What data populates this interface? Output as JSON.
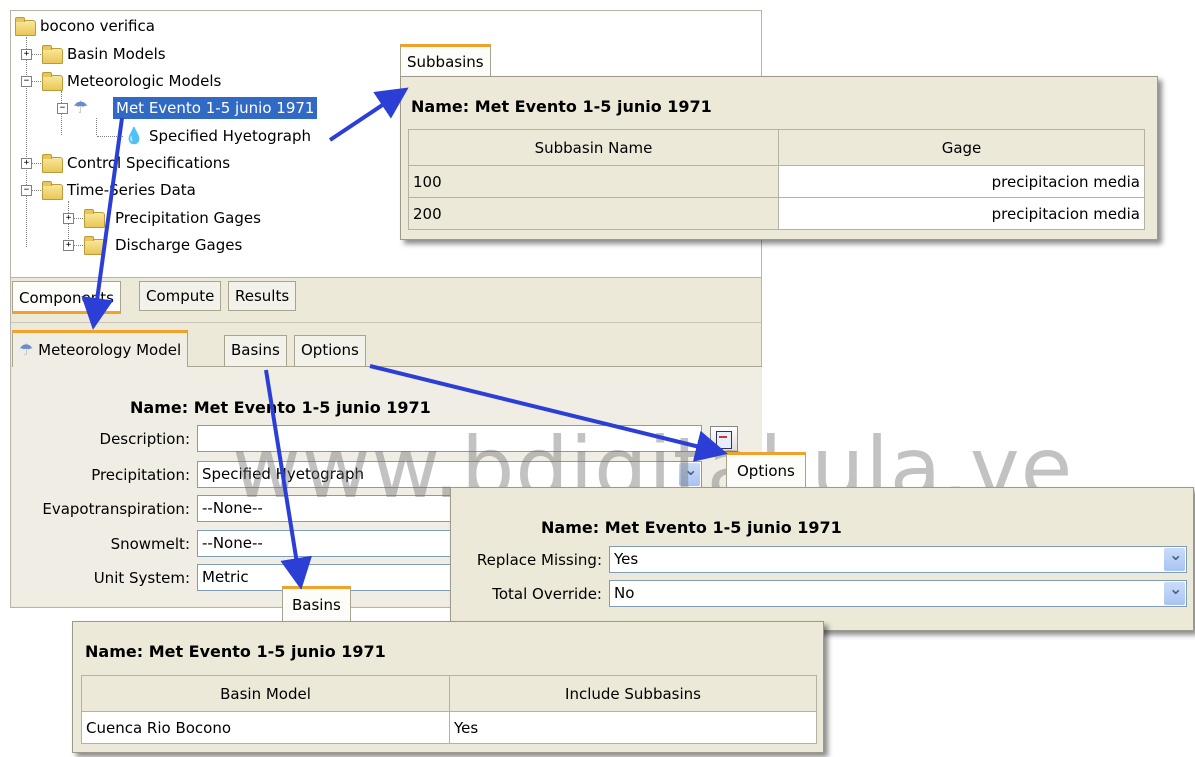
{
  "tree": {
    "root": "bocono verifica",
    "items": [
      {
        "label": "Basin Models"
      },
      {
        "label": "Meteorologic Models"
      },
      {
        "label": "Met Evento 1-5 junio 1971"
      },
      {
        "label": "Specified Hyetograph"
      },
      {
        "label": "Control Specifications"
      },
      {
        "label": "Time-Series Data"
      },
      {
        "label": "Precipitation Gages"
      },
      {
        "label": "Discharge Gages"
      }
    ]
  },
  "bottom_tabs": [
    "Components",
    "Compute",
    "Results"
  ],
  "editor_tabs": [
    "Meteorology Model",
    "Basins",
    "Options"
  ],
  "meteo_form": {
    "name_label": "Name:",
    "name_value": "Met Evento 1-5 junio 1971",
    "description_label": "Description:",
    "description_value": "",
    "precipitation_label": "Precipitation:",
    "precipitation_value": "Specified Hyetograph",
    "evapo_label": "Evapotranspiration:",
    "evapo_value": "--None--",
    "snowmelt_label": "Snowmelt:",
    "snowmelt_value": "--None--",
    "unit_label": "Unit System:",
    "unit_value": "Metric"
  },
  "subbasins_popup": {
    "tab": "Subbasins",
    "name_label": "Name:",
    "name_value": "Met Evento 1-5 junio 1971",
    "headers": [
      "Subbasin Name",
      "Gage"
    ],
    "rows": [
      [
        "100",
        "precipitacion media"
      ],
      [
        "200",
        "precipitacion media"
      ]
    ]
  },
  "options_popup": {
    "tab": "Options",
    "name_label": "Name:",
    "name_value": "Met Evento 1-5 junio 1971",
    "replace_label": "Replace Missing:",
    "replace_value": "Yes",
    "override_label": "Total Override:",
    "override_value": "No"
  },
  "basins_popup": {
    "tab": "Basins",
    "name_label": "Name:",
    "name_value": "Met Evento 1-5 junio 1971",
    "headers": [
      "Basin Model",
      "Include Subbasins"
    ],
    "rows": [
      [
        "Cuenca Rio Bocono",
        "Yes"
      ]
    ]
  },
  "watermark": "www.bdigital.ula.ve",
  "colors": {
    "arrow": "#2b3fd6",
    "tab_accent": "#f1a22a",
    "selection": "#316ac5"
  }
}
